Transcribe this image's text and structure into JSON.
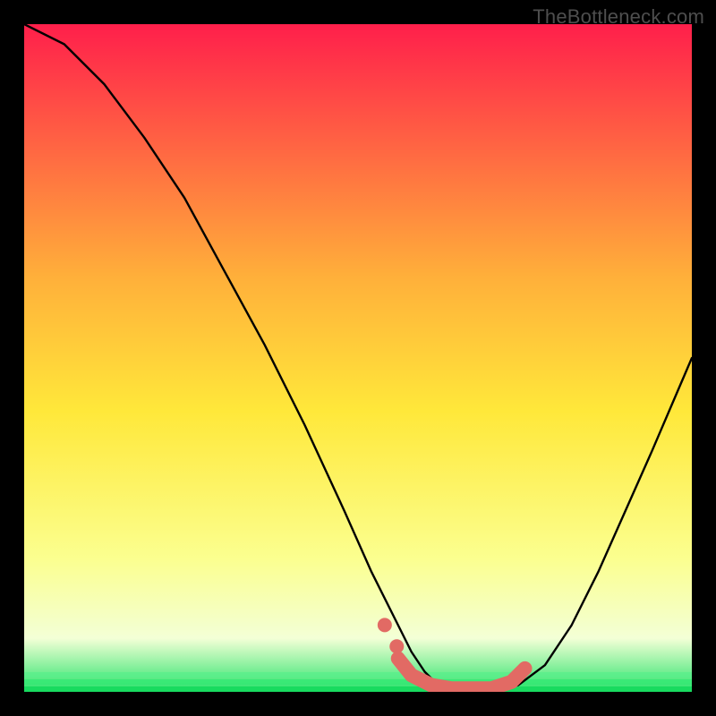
{
  "watermark": "TheBottleneck.com",
  "colors": {
    "background": "#000000",
    "gradient_top": "#ff1f4b",
    "gradient_mid_up": "#ffb03a",
    "gradient_mid": "#ffe83a",
    "gradient_low": "#fbff8f",
    "gradient_band": "#f3ffd6",
    "gradient_bottom": "#27e36a",
    "curve": "#000000",
    "marker": "#e26a64"
  },
  "chart_data": {
    "type": "line",
    "title": "",
    "xlabel": "",
    "ylabel": "",
    "x_range": [
      0,
      100
    ],
    "y_range": [
      0,
      100
    ],
    "series": [
      {
        "name": "bottleneck-curve",
        "x": [
          0,
          6,
          12,
          18,
          24,
          30,
          36,
          42,
          48,
          52,
          56,
          58,
          60,
          62,
          66,
          70,
          74,
          78,
          82,
          86,
          90,
          94,
          100
        ],
        "y": [
          100,
          97,
          91,
          83,
          74,
          63,
          52,
          40,
          27,
          18,
          10,
          6,
          3,
          1,
          0,
          0,
          1,
          4,
          10,
          18,
          27,
          36,
          50
        ]
      }
    ],
    "markers": {
      "name": "highlight-band",
      "x": [
        56,
        58,
        61,
        64,
        67,
        70,
        73,
        75
      ],
      "y": [
        5.0,
        2.5,
        1.0,
        0.5,
        0.5,
        0.5,
        1.5,
        3.5
      ]
    }
  }
}
